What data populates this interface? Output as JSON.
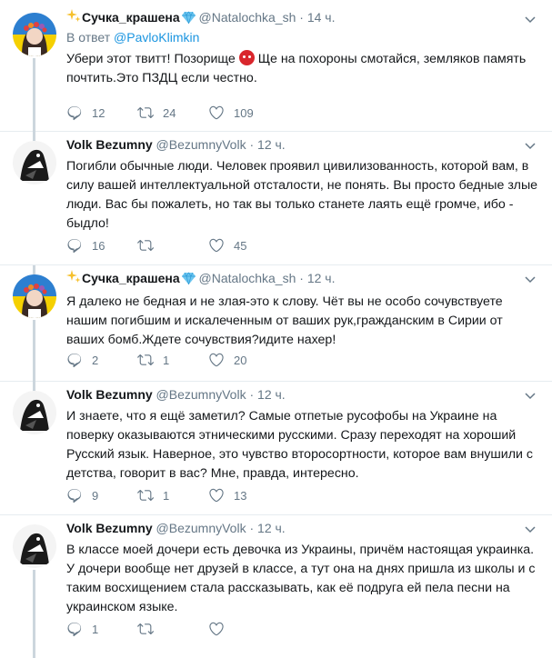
{
  "tweets": [
    {
      "name": "Сучка_крашена",
      "handle": "@Natalochka_sh",
      "dot": "·",
      "time": "14 ч.",
      "reply_prefix": "В ответ",
      "reply_to": "@PavloKlimkin",
      "text_before_emoji": "Убери этот твитт! Позорище ",
      "text_after_emoji": " Ще на похороны смотайся, земляков память почтить.Это ПЗДЦ если честно.",
      "replies": "12",
      "retweets": "24",
      "likes": "109"
    },
    {
      "name": "Volk Bezumny",
      "handle": "@BezumnyVolk",
      "dot": "·",
      "time": "12 ч.",
      "text": "Погибли обычные люди. Человек проявил цивилизованность, которой вам, в силу вашей интеллектуальной отсталости, не понять. Вы просто бедные злые люди. Вас бы пожалеть, но так вы только станете лаять ещё громче, ибо - быдло!",
      "replies": "16",
      "retweets": "",
      "likes": "45"
    },
    {
      "name": "Сучка_крашена",
      "handle": "@Natalochka_sh",
      "dot": "·",
      "time": "12 ч.",
      "text": "Я далеко не бедная и не злая-это к слову. Чёт вы не особо сочувствуете нашим погибшим и искалеченным от ваших рук,гражданским в Сирии от ваших бомб.Ждете сочувствия?идите нахер!",
      "replies": "2",
      "retweets": "1",
      "likes": "20"
    },
    {
      "name": "Volk Bezumny",
      "handle": "@BezumnyVolk",
      "dot": "·",
      "time": "12 ч.",
      "text": "И знаете, что я ещё заметил? Самые отпетые русофобы на Украине на поверку оказываются этническими русскими. Сразу переходят на хороший Русский язык. Наверное, это чувство  второсортности, которое вам внушили с детства, говорит в вас? Мне, правда, интересно.",
      "replies": "9",
      "retweets": "1",
      "likes": "13"
    },
    {
      "name": "Volk Bezumny",
      "handle": "@BezumnyVolk",
      "dot": "·",
      "time": "12 ч.",
      "text": "В классе моей дочери есть девочка из Украины, причём настоящая украинка. У дочери вообще нет друзей в классе, а тут она на днях пришла из школы и с таким восхищением стала рассказывать, как её подруга ей пела песни на украинском языке.",
      "replies": "1",
      "retweets": "",
      "likes": ""
    }
  ],
  "colors": {
    "accent": "#1b95e0",
    "muted": "#657786",
    "line": "#ccd6dd",
    "verified": "#1da1f2"
  }
}
